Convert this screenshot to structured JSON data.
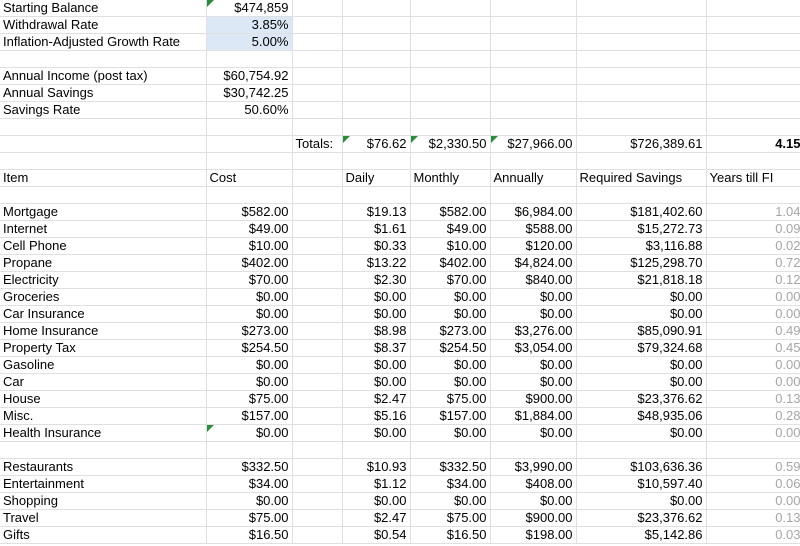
{
  "summary": {
    "starting_balance_label": "Starting Balance",
    "starting_balance": "$474,859",
    "withdrawal_rate_label": "Withdrawal Rate",
    "withdrawal_rate": "3.85%",
    "growth_rate_label": "Inflation-Adjusted Growth Rate",
    "growth_rate": "5.00%",
    "annual_income_label": "Annual Income (post tax)",
    "annual_income": "$60,754.92",
    "annual_savings_label": "Annual Savings",
    "annual_savings": "$30,742.25",
    "savings_rate_label": "Savings Rate",
    "savings_rate": "50.60%"
  },
  "totals": {
    "label": "Totals:",
    "daily": "$76.62",
    "monthly": "$2,330.50",
    "annually": "$27,966.00",
    "required_savings": "$726,389.61",
    "years_till_fi": "4.15"
  },
  "headers": {
    "item": "Item",
    "cost": "Cost",
    "daily": "Daily",
    "monthly": "Monthly",
    "annually": "Annually",
    "required_savings": "Required Savings",
    "years_till_fi": "Years till FI"
  },
  "group1": [
    {
      "item": "Mortgage",
      "cost": "$582.00",
      "daily": "$19.13",
      "monthly": "$582.00",
      "annually": "$6,984.00",
      "req": "$181,402.60",
      "years": "1.04"
    },
    {
      "item": "Internet",
      "cost": "$49.00",
      "daily": "$1.61",
      "monthly": "$49.00",
      "annually": "$588.00",
      "req": "$15,272.73",
      "years": "0.09"
    },
    {
      "item": "Cell Phone",
      "cost": "$10.00",
      "daily": "$0.33",
      "monthly": "$10.00",
      "annually": "$120.00",
      "req": "$3,116.88",
      "years": "0.02"
    },
    {
      "item": "Propane",
      "cost": "$402.00",
      "daily": "$13.22",
      "monthly": "$402.00",
      "annually": "$4,824.00",
      "req": "$125,298.70",
      "years": "0.72"
    },
    {
      "item": "Electricity",
      "cost": "$70.00",
      "daily": "$2.30",
      "monthly": "$70.00",
      "annually": "$840.00",
      "req": "$21,818.18",
      "years": "0.12"
    },
    {
      "item": "Groceries",
      "cost": "$0.00",
      "daily": "$0.00",
      "monthly": "$0.00",
      "annually": "$0.00",
      "req": "$0.00",
      "years": "0.00"
    },
    {
      "item": "Car Insurance",
      "cost": "$0.00",
      "daily": "$0.00",
      "monthly": "$0.00",
      "annually": "$0.00",
      "req": "$0.00",
      "years": "0.00"
    },
    {
      "item": "Home Insurance",
      "cost": "$273.00",
      "daily": "$8.98",
      "monthly": "$273.00",
      "annually": "$3,276.00",
      "req": "$85,090.91",
      "years": "0.49"
    },
    {
      "item": "Property Tax",
      "cost": "$254.50",
      "daily": "$8.37",
      "monthly": "$254.50",
      "annually": "$3,054.00",
      "req": "$79,324.68",
      "years": "0.45"
    },
    {
      "item": "Gasoline",
      "cost": "$0.00",
      "daily": "$0.00",
      "monthly": "$0.00",
      "annually": "$0.00",
      "req": "$0.00",
      "years": "0.00"
    },
    {
      "item": "Car",
      "cost": "$0.00",
      "daily": "$0.00",
      "monthly": "$0.00",
      "annually": "$0.00",
      "req": "$0.00",
      "years": "0.00"
    },
    {
      "item": "House",
      "cost": "$75.00",
      "daily": "$2.47",
      "monthly": "$75.00",
      "annually": "$900.00",
      "req": "$23,376.62",
      "years": "0.13"
    },
    {
      "item": "Misc.",
      "cost": "$157.00",
      "daily": "$5.16",
      "monthly": "$157.00",
      "annually": "$1,884.00",
      "req": "$48,935.06",
      "years": "0.28"
    },
    {
      "item": "Health Insurance",
      "cost": "$0.00",
      "daily": "$0.00",
      "monthly": "$0.00",
      "annually": "$0.00",
      "req": "$0.00",
      "years": "0.00"
    }
  ],
  "group2": [
    {
      "item": "Restaurants",
      "cost": "$332.50",
      "daily": "$10.93",
      "monthly": "$332.50",
      "annually": "$3,990.00",
      "req": "$103,636.36",
      "years": "0.59"
    },
    {
      "item": "Entertainment",
      "cost": "$34.00",
      "daily": "$1.12",
      "monthly": "$34.00",
      "annually": "$408.00",
      "req": "$10,597.40",
      "years": "0.06"
    },
    {
      "item": "Shopping",
      "cost": "$0.00",
      "daily": "$0.00",
      "monthly": "$0.00",
      "annually": "$0.00",
      "req": "$0.00",
      "years": "0.00"
    },
    {
      "item": "Travel",
      "cost": "$75.00",
      "daily": "$2.47",
      "monthly": "$75.00",
      "annually": "$900.00",
      "req": "$23,376.62",
      "years": "0.13"
    },
    {
      "item": "Gifts",
      "cost": "$16.50",
      "daily": "$0.54",
      "monthly": "$16.50",
      "annually": "$198.00",
      "req": "$5,142.86",
      "years": "0.03"
    }
  ],
  "colors": {
    "selected_cell_bg": "#dce8f5",
    "comment_marker": "#2e8b3e",
    "muted_text": "#a6a6a6",
    "gridline": "#e0e0e0"
  }
}
